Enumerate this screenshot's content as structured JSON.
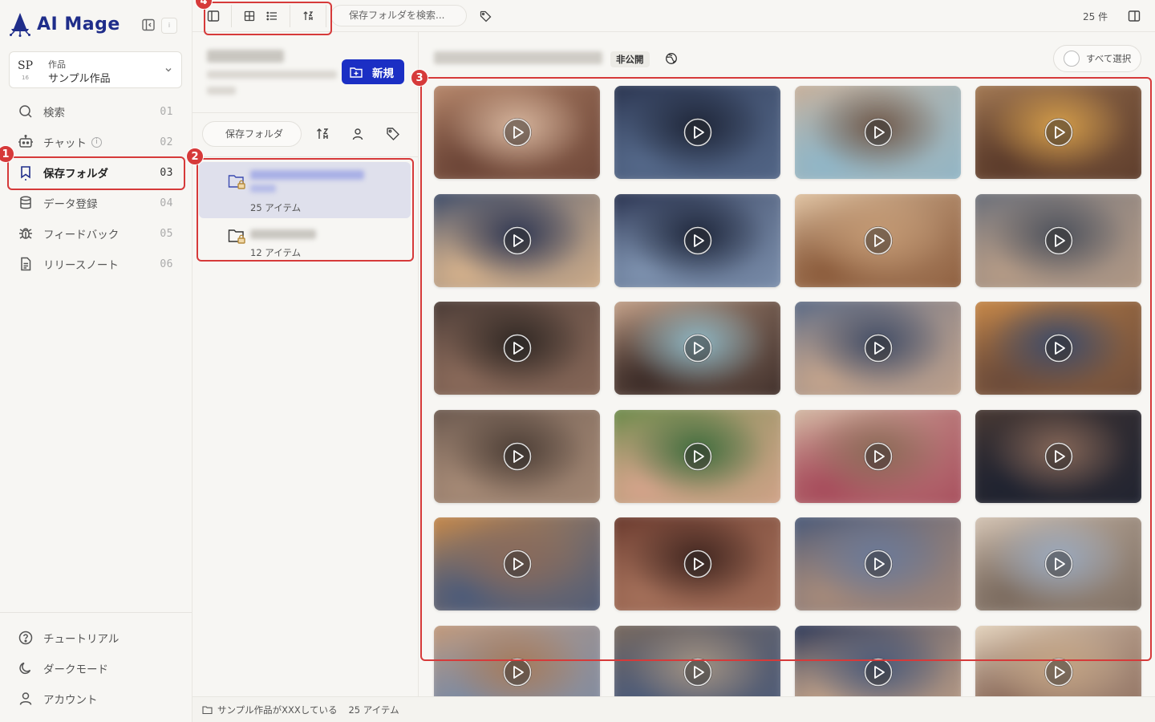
{
  "app": {
    "name": "AI Mage",
    "mini_badge": "i"
  },
  "project": {
    "abbr": "SP",
    "num": "16",
    "category": "作品",
    "name": "サンプル作品"
  },
  "nav": [
    {
      "label": "検索",
      "num": "01",
      "icon": "search-icon"
    },
    {
      "label": "チャット",
      "num": "02",
      "icon": "bot-icon"
    },
    {
      "label": "保存フォルダ",
      "num": "03",
      "icon": "bookmark-icon",
      "active": true
    },
    {
      "label": "データ登録",
      "num": "04",
      "icon": "database-icon"
    },
    {
      "label": "フィードバック",
      "num": "05",
      "icon": "bug-icon"
    },
    {
      "label": "リリースノート",
      "num": "06",
      "icon": "document-icon"
    }
  ],
  "footer_nav": [
    {
      "label": "チュートリアル",
      "icon": "help-circle-icon"
    },
    {
      "label": "ダークモード",
      "icon": "moon-icon"
    },
    {
      "label": "アカウント",
      "icon": "user-icon"
    }
  ],
  "topbar": {
    "search_placeholder": "保存フォルダを検索...",
    "count": "25 件"
  },
  "folder_panel": {
    "new_label": "新規",
    "filter_label": "保存フォルダ",
    "folders": [
      {
        "count": "25 アイテム",
        "selected": true
      },
      {
        "count": "12 アイテム",
        "selected": false
      }
    ]
  },
  "main": {
    "visibility": "非公開",
    "select_all": "すべて選択"
  },
  "status": {
    "folder": "サンプル作品がXXXしている",
    "count": "25 アイテム"
  },
  "annotations": [
    "1",
    "2",
    "3",
    "4"
  ],
  "colors": {
    "accent": "#1b2fc4",
    "brand": "#1f2d8a",
    "annotation": "#d63a3a",
    "selected_folder": "#dfe0ec"
  }
}
